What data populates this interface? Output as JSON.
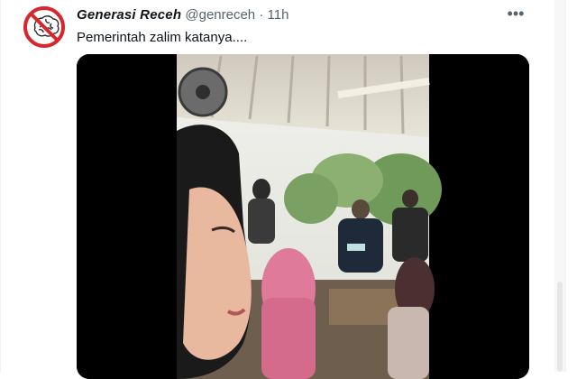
{
  "tweet": {
    "author_name": "Generasi Receh",
    "handle": "@genreceh",
    "separator": "·",
    "time": "11h",
    "more_label": "•••",
    "text": "Pemerintah zalim katanya...."
  },
  "avatar": {
    "icon": "no-brain-icon",
    "ring_color": "#d9262c"
  },
  "media": {
    "type": "video-thumbnail"
  }
}
